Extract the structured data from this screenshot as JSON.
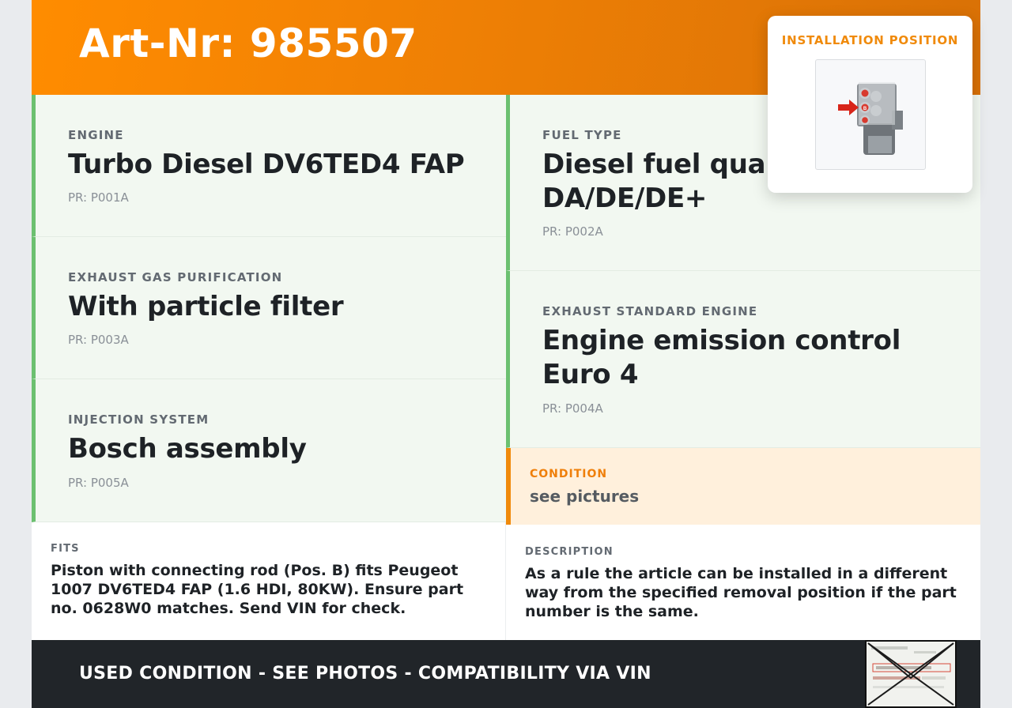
{
  "header": {
    "title": "Art-Nr: 985507"
  },
  "installation": {
    "label": "INSTALLATION POSITION",
    "position_marker": "B"
  },
  "specs": {
    "engine": {
      "label": "ENGINE",
      "value": "Turbo Diesel DV6TED4 FAP",
      "pr": "PR: P001A"
    },
    "fuel_type": {
      "label": "FUEL TYPE",
      "value": "Diesel fuel quality DA/DE/DE+",
      "pr": "PR: P002A"
    },
    "exhaust_purification": {
      "label": "EXHAUST GAS PURIFICATION",
      "value": "With particle filter",
      "pr": "PR: P003A"
    },
    "exhaust_standard": {
      "label": "EXHAUST STANDARD ENGINE",
      "value": "Engine emission control Euro 4",
      "pr": "PR: P004A"
    },
    "injection": {
      "label": "INJECTION SYSTEM",
      "value": "Bosch assembly",
      "pr": "PR: P005A"
    }
  },
  "condition": {
    "label": "CONDITION",
    "value": "see pictures"
  },
  "fits": {
    "label": "FITS",
    "text": "Piston with connecting rod (Pos. B) fits Peugeot 1007 DV6TED4 FAP (1.6 HDI, 80KW). Ensure part no. 0628W0 matches. Send VIN for check."
  },
  "description": {
    "label": "DESCRIPTION",
    "text": "As a rule the article can be installed in a different way from the specified removal position if the part number is the same."
  },
  "footer": {
    "text": "USED CONDITION - SEE PHOTOS - COMPATIBILITY VIA VIN"
  },
  "colors": {
    "header_orange": "#ff8c00",
    "spec_background": "#f2f8f1",
    "spec_accent_green": "#6cc070",
    "condition_background": "#fff0dc",
    "condition_accent": "#f08a0b",
    "footer_background": "#212529"
  }
}
